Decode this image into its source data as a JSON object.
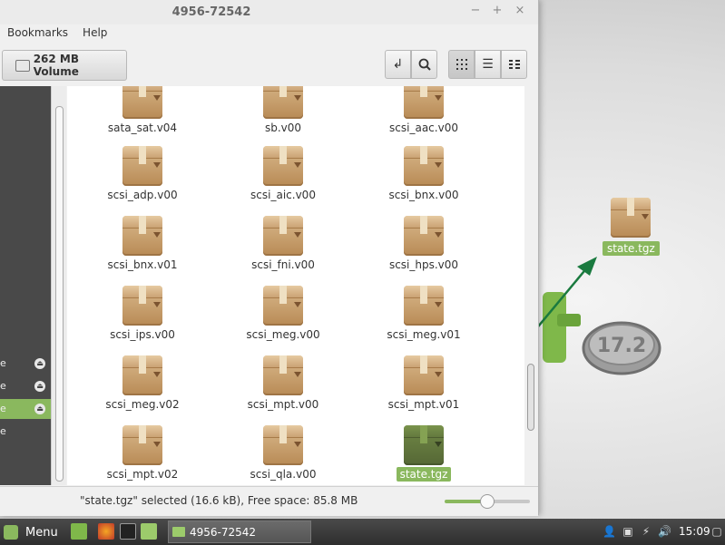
{
  "window": {
    "title": "4956-72542",
    "controls": {
      "minimize": "−",
      "maximize": "+",
      "close": "×"
    },
    "menu": [
      "Bookmarks",
      "Help"
    ],
    "toolbar": {
      "location_label": "262 MB Volume",
      "toggle_path_icon": "return-arrow-icon",
      "search_icon": "search-icon",
      "views": [
        "icon-view",
        "list-view",
        "compact-view"
      ],
      "active_view": "icon-view"
    },
    "sidebar": {
      "rows": [
        {
          "label": "e",
          "eject": "⏏",
          "selected": false
        },
        {
          "label": "e",
          "eject": "⏏",
          "selected": false
        },
        {
          "label": "e",
          "eject": "⏏",
          "selected": true
        },
        {
          "label": "e",
          "eject": "",
          "selected": false
        }
      ]
    },
    "files": [
      {
        "name": "sata_sat.v04"
      },
      {
        "name": "sb.v00"
      },
      {
        "name": "scsi_aac.v00"
      },
      {
        "name": "scsi_adp.v00"
      },
      {
        "name": "scsi_aic.v00"
      },
      {
        "name": "scsi_bnx.v00"
      },
      {
        "name": "scsi_bnx.v01"
      },
      {
        "name": "scsi_fni.v00"
      },
      {
        "name": "scsi_hps.v00"
      },
      {
        "name": "scsi_ips.v00"
      },
      {
        "name": "scsi_meg.v00"
      },
      {
        "name": "scsi_meg.v01"
      },
      {
        "name": "scsi_meg.v02"
      },
      {
        "name": "scsi_mpt.v00"
      },
      {
        "name": "scsi_mpt.v01"
      },
      {
        "name": "scsi_mpt.v02"
      },
      {
        "name": "scsi_qla.v00"
      },
      {
        "name": "state.tgz",
        "selected": true
      }
    ],
    "status": {
      "text": "\"state.tgz\" selected (16.6 kB), Free space: 85.8 MB",
      "zoom_level": 0.5
    }
  },
  "desktop": {
    "icon_label": "state.tgz",
    "logo_text": "17.2"
  },
  "taskbar": {
    "menu_label": "Menu",
    "window_button": "4956-72542",
    "tray_icons": [
      "user-icon",
      "shield-icon",
      "network-icon",
      "volume-icon"
    ],
    "clock": "15:09"
  },
  "colors": {
    "accent": "#8ab85e",
    "sidebar": "#494949",
    "taskbar": "#3a3a3a",
    "arrow": "#1a7a3f"
  }
}
